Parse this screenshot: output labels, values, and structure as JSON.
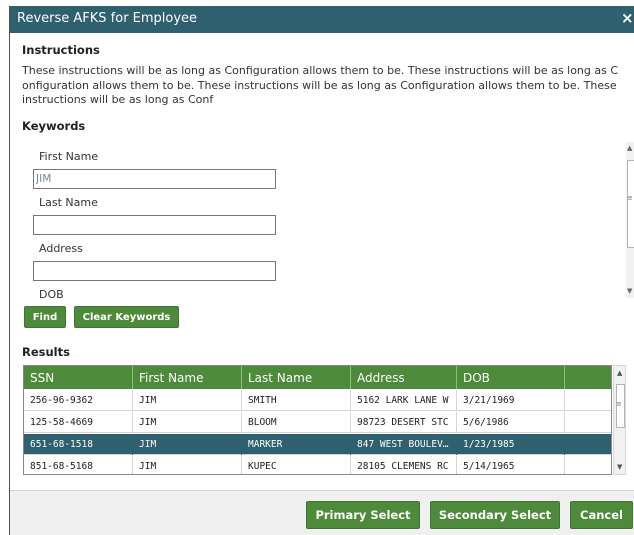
{
  "dialog": {
    "title": "Reverse AFKS for Employee",
    "close_glyph": "×"
  },
  "instructions": {
    "heading": "Instructions",
    "lines": [
      "These instructions will be as long as Configuration allows them to be. These instructions will be as long as C",
      "onfiguration allows them to be. These instructions will be as long as Configuration allows them to be. These",
      "instructions will be as long as Conf"
    ]
  },
  "keywords": {
    "heading": "Keywords",
    "first_name_label": "First Name",
    "first_name_value": "JIM",
    "last_name_label": "Last Name",
    "last_name_value": "",
    "address_label": "Address",
    "address_value": "",
    "dob_label": "DOB"
  },
  "buttons": {
    "find": "Find",
    "clear_keywords": "Clear Keywords",
    "primary_select": "Primary Select",
    "secondary_select": "Secondary Select",
    "cancel": "Cancel"
  },
  "results": {
    "heading": "Results",
    "columns": [
      "SSN",
      "First Name",
      "Last Name",
      "Address",
      "DOB",
      ""
    ],
    "rows": [
      {
        "ssn": "256-96-9362",
        "first": "JIM",
        "last": "SMITH",
        "address": "5162 LARK LANE W",
        "dob": "3/21/1969",
        "selected": false
      },
      {
        "ssn": "125-58-4669",
        "first": "JIM",
        "last": "BLOOM",
        "address": "98723 DESERT STC",
        "dob": "5/6/1986",
        "selected": false
      },
      {
        "ssn": "651-68-1518",
        "first": "JIM",
        "last": "MARKER",
        "address": "847 WEST BOULEV…",
        "dob": "1/23/1985",
        "selected": true
      },
      {
        "ssn": "851-68-5168",
        "first": "JIM",
        "last": "KUPEC",
        "address": "28105 CLEMENS RC",
        "dob": "5/14/1965",
        "selected": false
      }
    ]
  },
  "colors": {
    "title_bar": "#2e6070",
    "accent_green": "#4d8a3a",
    "selected_row": "#2e6070"
  },
  "icons": {
    "close": "close-icon",
    "scroll_up": "chevron-up-icon",
    "scroll_down": "chevron-down-icon",
    "scroll_grip": "grip-icon"
  }
}
